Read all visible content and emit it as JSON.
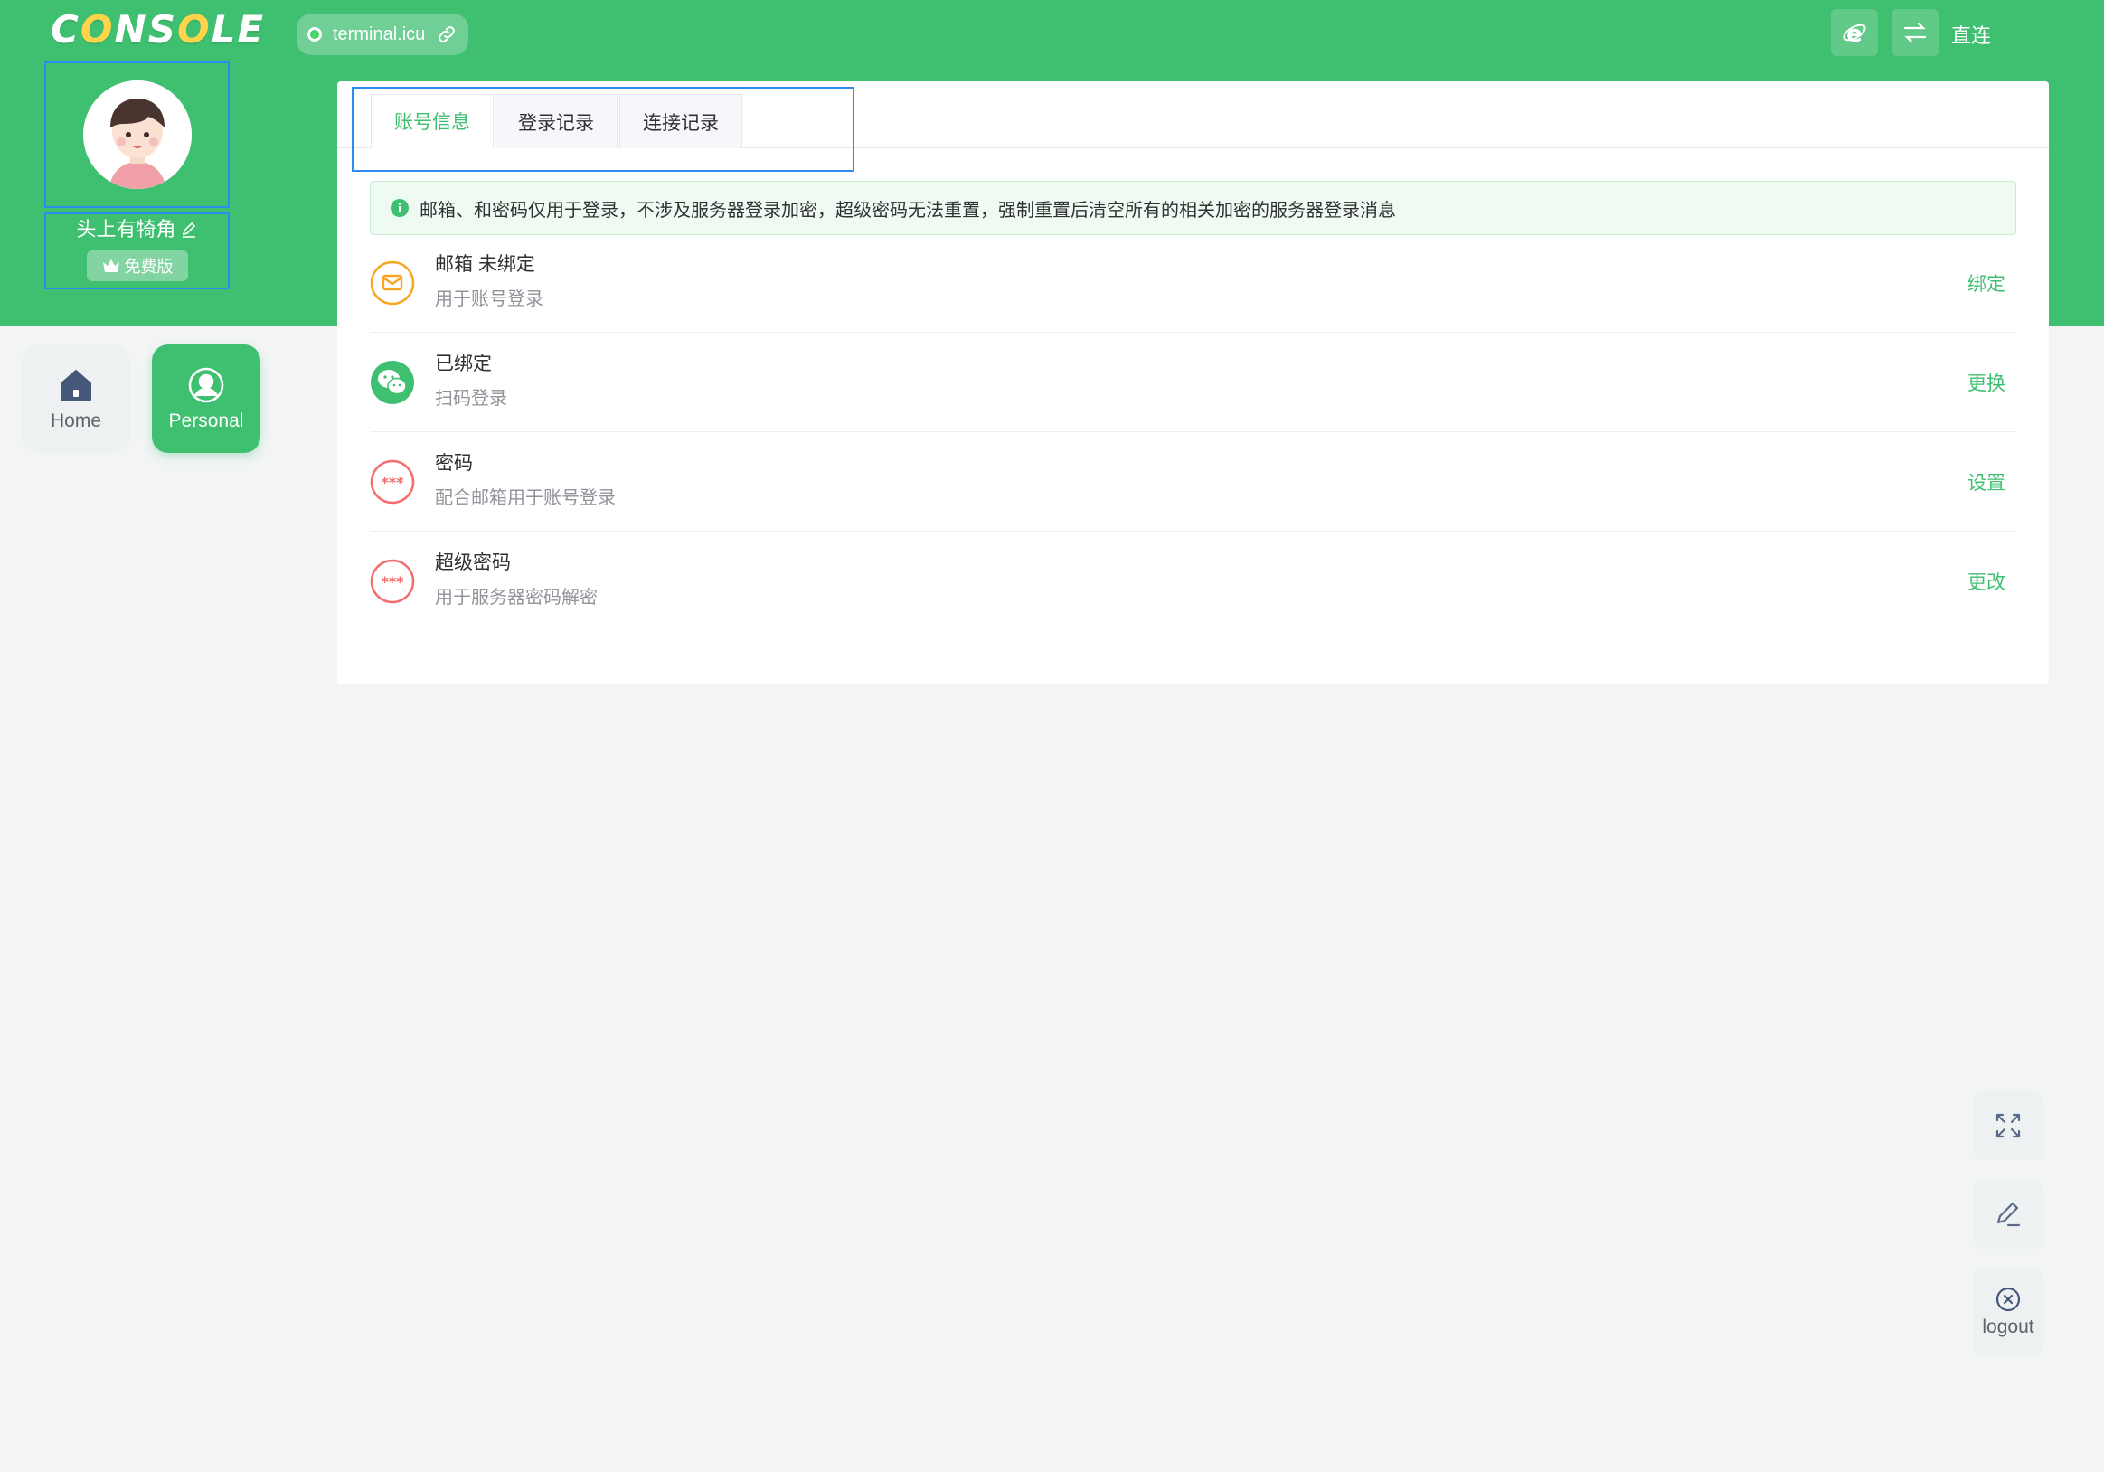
{
  "header": {
    "logo_prefix": "C",
    "logo_o1": "O",
    "logo_mid": "NS",
    "logo_o2": "O",
    "logo_suffix": "LE",
    "host": "terminal.icu",
    "connection_mode": "直连",
    "icons": [
      "ie-icon",
      "switch-icon",
      "link-icon"
    ]
  },
  "profile": {
    "name": "头上有犄角",
    "plan": "免费版"
  },
  "nav": {
    "home_label": "Home",
    "personal_label": "Personal"
  },
  "tabs": [
    {
      "label": "账号信息",
      "active": true
    },
    {
      "label": "登录记录",
      "active": false
    },
    {
      "label": "连接记录",
      "active": false
    }
  ],
  "notice": "邮箱、和密码仅用于登录，不涉及服务器登录加密，超级密码无法重置，强制重置后清空所有的相关加密的服务器登录消息",
  "rows": [
    {
      "title": "邮箱 未绑定",
      "desc": "用于账号登录",
      "action": "绑定",
      "icon": "mail-icon"
    },
    {
      "title": "已绑定",
      "desc": "扫码登录",
      "action": "更换",
      "icon": "wechat-icon"
    },
    {
      "title": "密码",
      "desc": "配合邮箱用于账号登录",
      "action": "设置",
      "icon": "password-icon"
    },
    {
      "title": "超级密码",
      "desc": "用于服务器密码解密",
      "action": "更改",
      "icon": "super-password-icon"
    }
  ],
  "tools": {
    "logout_label": "logout"
  },
  "colors": {
    "brand_green": "#3fbf70",
    "accent_yellow": "#ffd44a",
    "mail_orange": "#f5a623",
    "password_red": "#f56c6c",
    "selection_blue": "#2d8cf0"
  }
}
